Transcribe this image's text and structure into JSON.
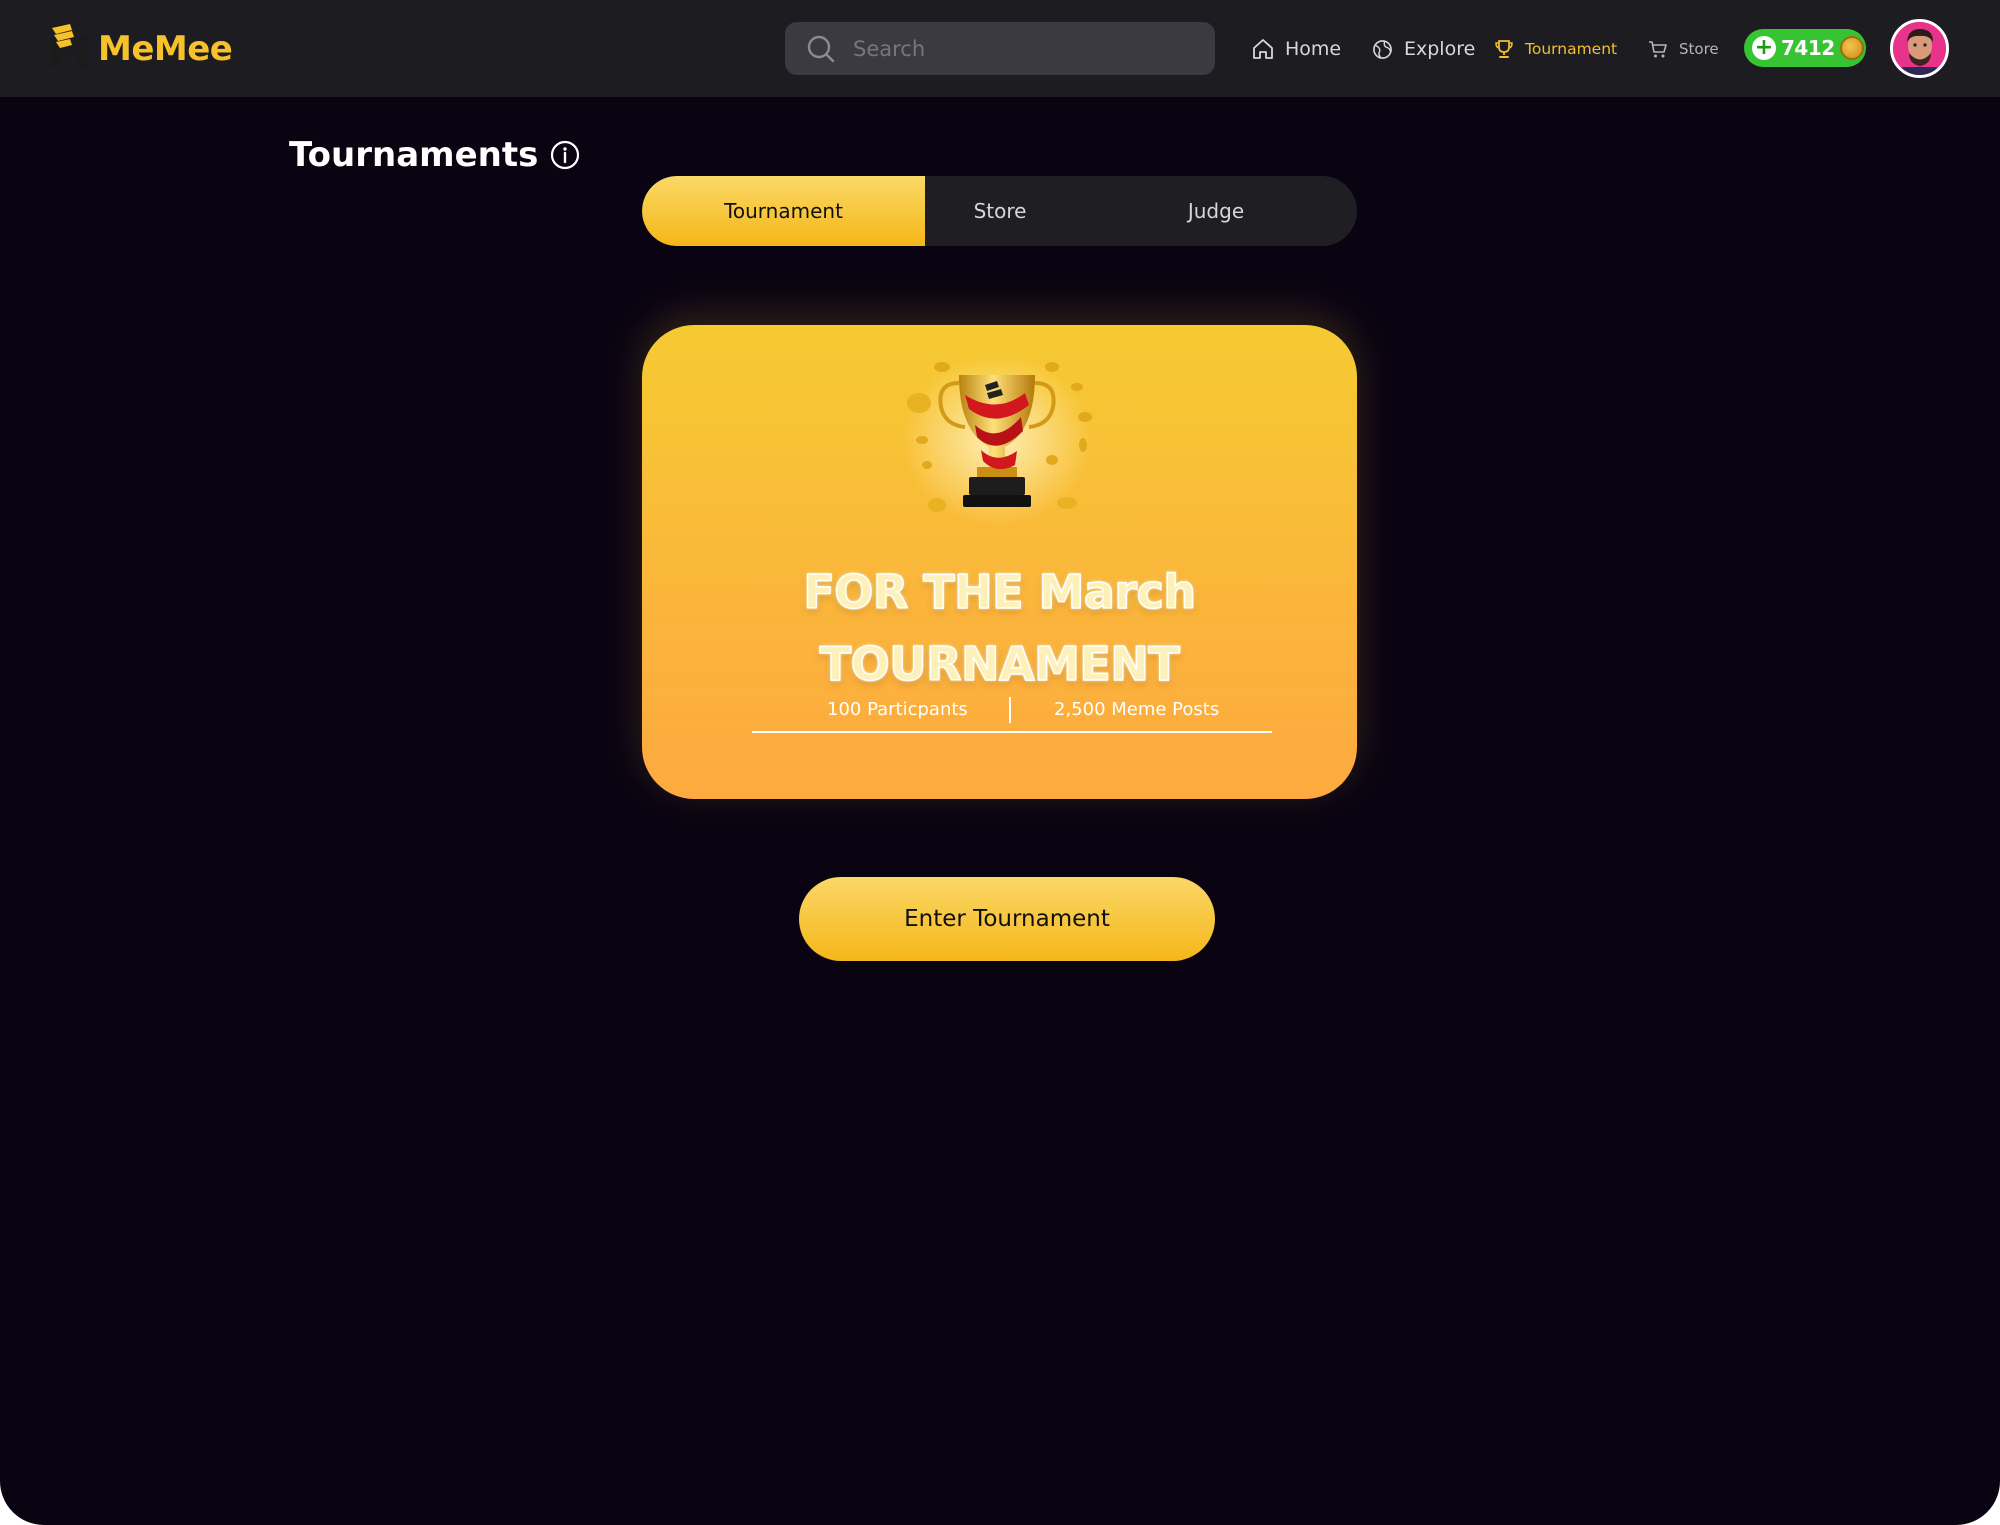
{
  "app": {
    "brand": "MeMee"
  },
  "navbar": {
    "search": {
      "placeholder": "Search",
      "value": ""
    },
    "items": [
      {
        "label": "Home",
        "icon": "home-icon"
      },
      {
        "label": "Explore",
        "icon": "globe-icon"
      },
      {
        "label": "Tournament",
        "icon": "trophy-icon",
        "active": true
      },
      {
        "label": "Store",
        "icon": "cart-icon"
      }
    ],
    "coins": {
      "value": "7412",
      "icon": "coin-icon"
    },
    "avatar": {
      "icon": "avatar"
    }
  },
  "page": {
    "title": "Tournaments"
  },
  "tabs": [
    {
      "label": "Tournament",
      "active": true
    },
    {
      "label": "Store"
    },
    {
      "label": "Judge"
    }
  ],
  "card": {
    "title_line1": "FOR THE March",
    "title_line2": "TOURNAMENT",
    "stats": {
      "participants": "100 Particpants",
      "posts": "2,500 Meme Posts"
    }
  },
  "actions": {
    "enter_label": "Enter Tournament"
  },
  "colors": {
    "accent": "#f4b718",
    "background": "#0a0412",
    "navbar": "#1d1c21",
    "coins_badge": "#37c432",
    "card_top": "#f6ca32",
    "card_bottom": "#fda93f"
  }
}
